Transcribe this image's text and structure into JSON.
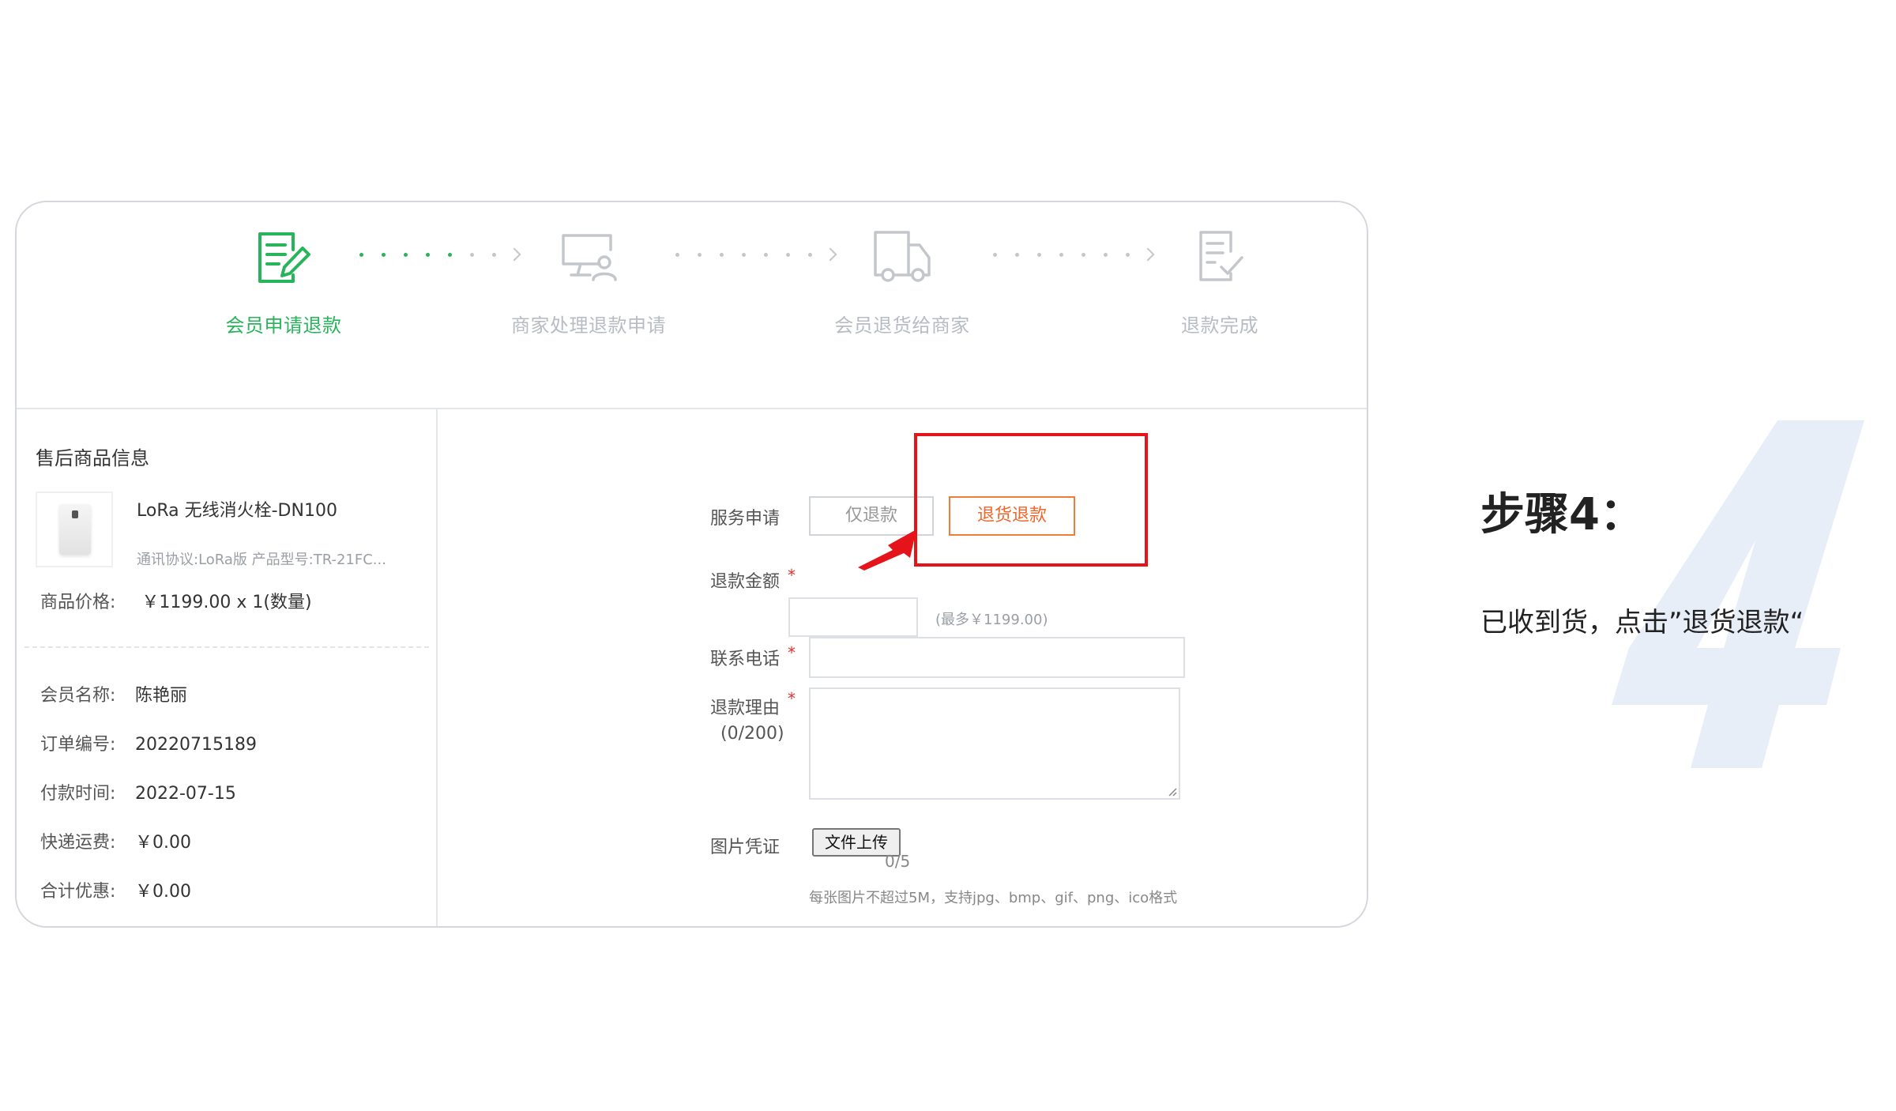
{
  "steps": [
    {
      "label": "会员申请退款",
      "icon": "edit-document-icon",
      "state": "active"
    },
    {
      "label": "商家处理退款申请",
      "icon": "monitor-user-icon",
      "state": "pending"
    },
    {
      "label": "会员退货给商家",
      "icon": "delivery-truck-icon",
      "state": "pending"
    },
    {
      "label": "退款完成",
      "icon": "document-check-icon",
      "state": "pending"
    }
  ],
  "product": {
    "section_title": "售后商品信息",
    "name": "LoRa 无线消火栓-DN100",
    "spec": "通讯协议:LoRa版 产品型号:TR-21FC...",
    "price_label": "商品价格:",
    "price_value": "￥1199.00 x 1(数量)"
  },
  "order_info": [
    {
      "key": "会员名称:",
      "value": "陈艳丽"
    },
    {
      "key": "订单编号:",
      "value": "20220715189"
    },
    {
      "key": "付款时间:",
      "value": "2022-07-15"
    },
    {
      "key": "快递运费:",
      "value": "￥0.00"
    },
    {
      "key": "合计优惠:",
      "value": "￥0.00"
    }
  ],
  "form": {
    "service_label": "服务申请",
    "option_refund_only": "仅退款",
    "option_return_refund": "退货退款",
    "selected_option": "退货退款",
    "amount_label": "退款金额",
    "amount_value": "",
    "amount_hint": "(最多￥1199.00)",
    "phone_label": "联系电话",
    "phone_value": "",
    "reason_label": "退款理由",
    "reason_counter": "(0/200)",
    "reason_value": "",
    "image_label": "图片凭证",
    "upload_button": "文件上传",
    "upload_count": "0/5",
    "upload_hint": "每张图片不超过5M，支持jpg、bmp、gif、png、ico格式",
    "required_mark": "*"
  },
  "instruction": {
    "title": "步骤4：",
    "description": "已收到货，点击”退货退款“"
  },
  "watermark_number": "4",
  "colors": {
    "active_green": "#27b45a",
    "inactive_gray": "#b7bcc3",
    "selected_orange": "#f07c36",
    "highlight_red": "#e5141b",
    "watermark_blue": "#e8eef8"
  }
}
